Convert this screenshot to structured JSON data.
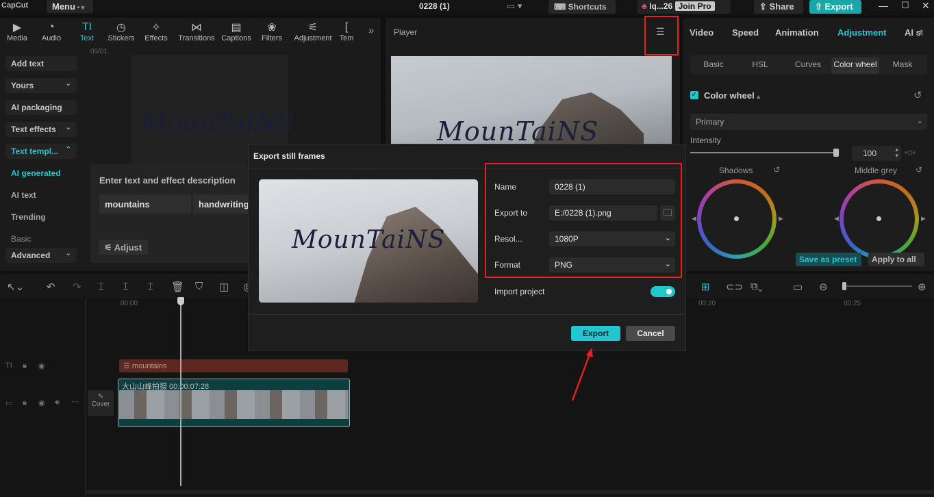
{
  "app": {
    "logo": "CapCut",
    "menu": "Menu",
    "project": "0228 (1)",
    "shortcuts": "Shortcuts",
    "user": "Iq...26",
    "join_pro": "Join Pro",
    "share": "Share",
    "export": "Export"
  },
  "toolbar_tabs": [
    {
      "label": "Media",
      "icon": "media-icon"
    },
    {
      "label": "Audio",
      "icon": "audio-icon"
    },
    {
      "label": "Text",
      "icon": "text-icon"
    },
    {
      "label": "Stickers",
      "icon": "stickers-icon"
    },
    {
      "label": "Effects",
      "icon": "effects-icon"
    },
    {
      "label": "Transitions",
      "icon": "transitions-icon"
    },
    {
      "label": "Captions",
      "icon": "captions-icon"
    },
    {
      "label": "Filters",
      "icon": "filters-icon"
    },
    {
      "label": "Adjustment",
      "icon": "adjustment-icon"
    },
    {
      "label": "Tem",
      "icon": "templates-icon"
    }
  ],
  "sidebar": {
    "add_text": "Add text",
    "yours": "Yours",
    "ai_packaging": "AI packaging",
    "text_effects": "Text effects",
    "text_templates": "Text templ...",
    "ai_generated": "AI generated",
    "ai_text": "AI text",
    "trending": "Trending",
    "basic": "Basic",
    "advanced": "Advanced"
  },
  "preview": {
    "date": "05/01",
    "text": "MounTaiNS"
  },
  "ai_prompt": {
    "label": "Enter text and effect description",
    "input_value": "mountains",
    "style_value": "handwriting",
    "adjust": "Adjust"
  },
  "player": {
    "title": "Player",
    "text": "MounTaiNS"
  },
  "right_panel": {
    "tabs": [
      "Video",
      "Speed",
      "Animation",
      "Adjustment",
      "AI styl"
    ],
    "subtabs": [
      "Basic",
      "HSL",
      "Curves",
      "Color wheel",
      "Mask"
    ],
    "color_wheel_label": "Color wheel",
    "mode": "Primary",
    "intensity_label": "Intensity",
    "intensity_value": "100",
    "intensity_level": 1.0,
    "shadows": "Shadows",
    "middle_grey": "Middle grey",
    "save_preset": "Save as preset",
    "apply_all": "Apply to all"
  },
  "dialog": {
    "title": "Export still frames",
    "thumb_text": "MounTaiNS",
    "name_label": "Name",
    "name_value": "0228 (1)",
    "export_to_label": "Export to",
    "export_to_value": "E:/0228 (1).png",
    "resolution_label": "Resol...",
    "resolution_value": "1080P",
    "format_label": "Format",
    "format_value": "PNG",
    "import_project": "Import project",
    "export_btn": "Export",
    "cancel_btn": "Cancel"
  },
  "timeline": {
    "t0": "00:00",
    "t20": "00:20",
    "t25": "00:25",
    "text_clip": "mountains",
    "video_clip": "大山山峰拍摄",
    "video_duration": "00:00:07:28",
    "cover": "Cover"
  },
  "colors": {
    "accent": "#22c6cf",
    "highlight_red": "#ea1f1f"
  }
}
